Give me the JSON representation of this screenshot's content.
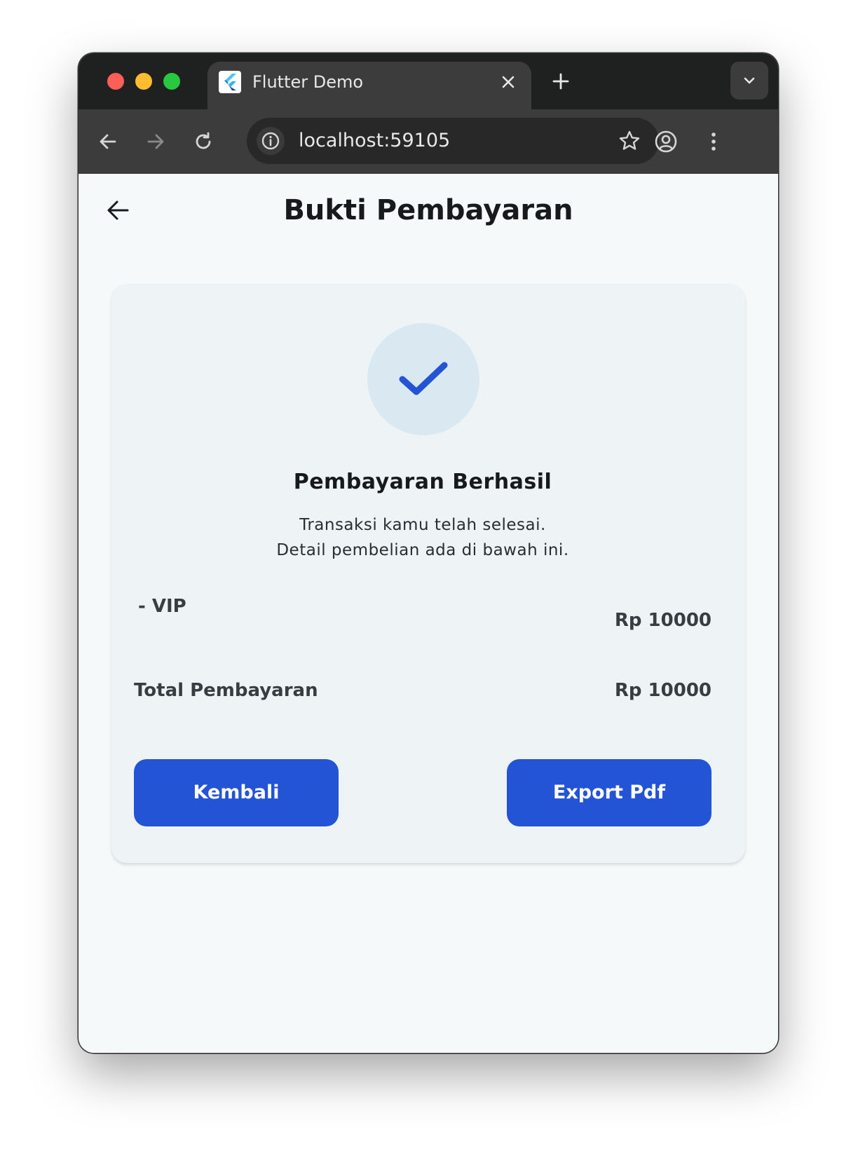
{
  "browser": {
    "tab_title": "Flutter Demo",
    "url": "localhost:59105"
  },
  "app": {
    "title": "Bukti Pembayaran"
  },
  "receipt": {
    "status_title": "Pembayaran Berhasil",
    "description_line1": "Transaksi kamu telah selesai.",
    "description_line2": "Detail pembelian ada di bawah ini.",
    "items": [
      {
        "name": "- VIP",
        "price": "Rp 10000"
      }
    ],
    "total_label": "Total Pembayaran",
    "total_value": "Rp 10000"
  },
  "actions": {
    "back_label": "Kembali",
    "export_label": "Export Pdf"
  },
  "colors": {
    "primary": "#2454d6",
    "check": "#2454d6",
    "check_bg": "#d9e8f1",
    "card_bg": "#eef3f6",
    "page_bg": "#f6f9fa"
  },
  "icons": {
    "favicon": "flutter-logo-icon",
    "success": "check-icon"
  }
}
